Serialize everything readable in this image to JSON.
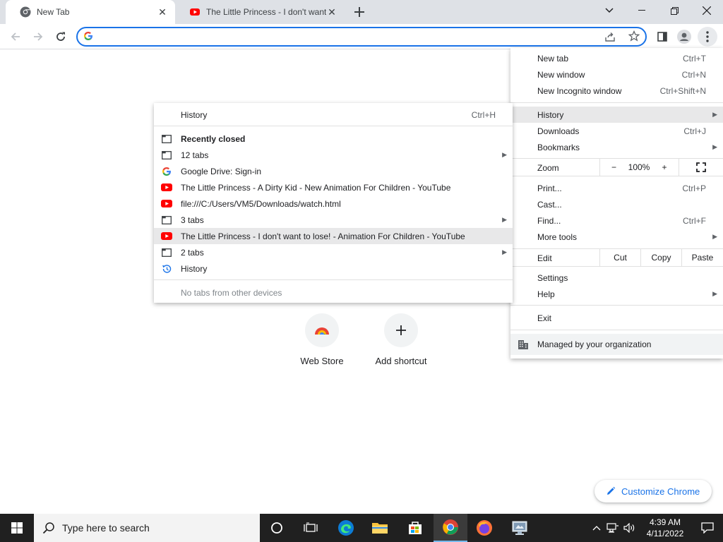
{
  "tabs": [
    {
      "title": "New Tab",
      "favicon": "chrome-icon",
      "active": true
    },
    {
      "title": "The Little Princess - I don't want",
      "favicon": "youtube-icon",
      "active": false
    }
  ],
  "omnibox": {
    "value": "",
    "placeholder": ""
  },
  "shortcuts": [
    {
      "label": "Web Store",
      "icon": "webstore-icon"
    },
    {
      "label": "Add shortcut",
      "icon": "plus-icon"
    }
  ],
  "customize_label": "Customize Chrome",
  "main_menu": {
    "new_tab": {
      "label": "New tab",
      "shortcut": "Ctrl+T"
    },
    "new_window": {
      "label": "New window",
      "shortcut": "Ctrl+N"
    },
    "new_incognito": {
      "label": "New Incognito window",
      "shortcut": "Ctrl+Shift+N"
    },
    "history": {
      "label": "History"
    },
    "downloads": {
      "label": "Downloads",
      "shortcut": "Ctrl+J"
    },
    "bookmarks": {
      "label": "Bookmarks"
    },
    "zoom": {
      "label": "Zoom",
      "minus": "−",
      "value": "100%",
      "plus": "+"
    },
    "print": {
      "label": "Print...",
      "shortcut": "Ctrl+P"
    },
    "cast": {
      "label": "Cast..."
    },
    "find": {
      "label": "Find...",
      "shortcut": "Ctrl+F"
    },
    "more_tools": {
      "label": "More tools"
    },
    "edit": {
      "label": "Edit",
      "cut": "Cut",
      "copy": "Copy",
      "paste": "Paste"
    },
    "settings": {
      "label": "Settings"
    },
    "help": {
      "label": "Help"
    },
    "exit": {
      "label": "Exit"
    },
    "managed": {
      "label": "Managed by your organization"
    }
  },
  "history_menu": {
    "history": {
      "label": "History",
      "shortcut": "Ctrl+H"
    },
    "recently_closed": {
      "label": "Recently closed"
    },
    "items": [
      {
        "label": "12 tabs",
        "icon": "tab-window-icon",
        "submenu": true
      },
      {
        "label": "Google Drive: Sign-in",
        "icon": "google-icon",
        "submenu": false
      },
      {
        "label": "The Little Princess - A Dirty Kid - New Animation For Children - YouTube",
        "icon": "youtube-icon",
        "submenu": false
      },
      {
        "label": "file:///C:/Users/VM5/Downloads/watch.html",
        "icon": "youtube-icon",
        "submenu": false
      },
      {
        "label": "3 tabs",
        "icon": "tab-window-icon",
        "submenu": true
      },
      {
        "label": "The Little Princess - I don't want to lose! - Animation For Children - YouTube",
        "icon": "youtube-icon",
        "submenu": false,
        "highlighted": true
      },
      {
        "label": "2 tabs",
        "icon": "tab-window-icon",
        "submenu": true
      },
      {
        "label": "History",
        "icon": "history-icon",
        "submenu": false
      }
    ],
    "no_tabs": {
      "label": "No tabs from other devices"
    }
  },
  "taskbar": {
    "search_placeholder": "Type here to search",
    "time": "4:39 AM",
    "date": "4/11/2022"
  },
  "colors": {
    "accent": "#1a73e8",
    "youtube": "#ff0000",
    "taskbar": "#202020"
  }
}
